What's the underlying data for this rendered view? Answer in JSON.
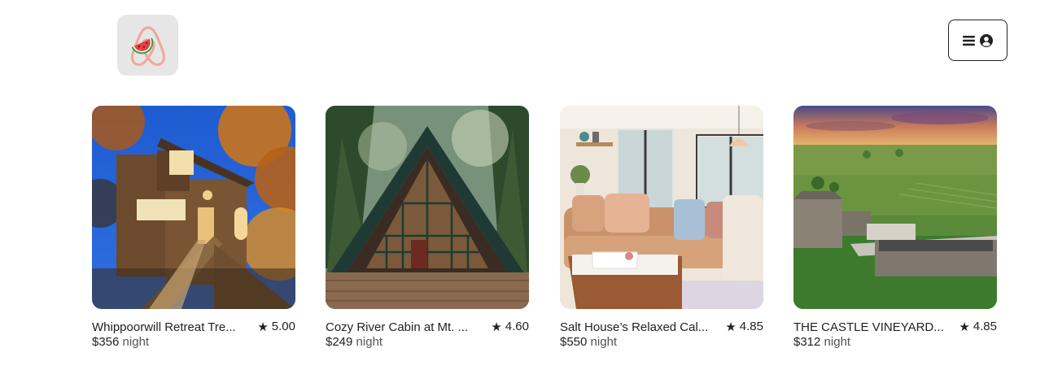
{
  "header": {
    "logo_icon": "watermelon-airbnb-logo-icon",
    "menu": {
      "menu_icon": "hamburger-icon",
      "account_icon": "user-circle-icon"
    }
  },
  "listings": [
    {
      "title": "Whippoorwill Retreat Tre...",
      "rating": "5.00",
      "price": "$356",
      "unit": "night",
      "image_desc": "treehouse-photo"
    },
    {
      "title": "Cozy River Cabin at Mt. ...",
      "rating": "4.60",
      "price": "$249",
      "unit": "night",
      "image_desc": "a-frame-cabin-photo"
    },
    {
      "title": "Salt House’s Relaxed Cal...",
      "rating": "4.85",
      "price": "$550",
      "unit": "night",
      "image_desc": "living-room-photo"
    },
    {
      "title": "THE CASTLE VINEYARD...",
      "rating": "4.85",
      "price": "$312",
      "unit": "night",
      "image_desc": "castle-vineyard-photo"
    }
  ],
  "colors": {
    "logo_bg": "#e6e6e6",
    "logo_pink": "#f2a69a",
    "watermelon_red": "#e8403c",
    "watermelon_green": "#3a9a4a",
    "text": "#222222",
    "muted": "#555555"
  }
}
